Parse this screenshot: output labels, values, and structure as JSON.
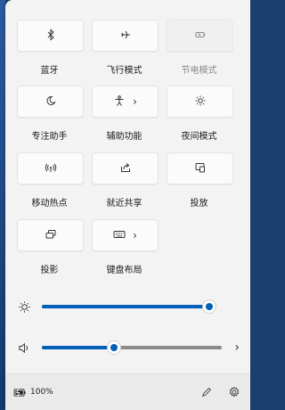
{
  "tiles": [
    {
      "label": "蓝牙",
      "icon": "bluetooth-icon",
      "chevron": false,
      "disabled": false
    },
    {
      "label": "飞行模式",
      "icon": "airplane-icon",
      "chevron": false,
      "disabled": false
    },
    {
      "label": "节电模式",
      "icon": "battery-saver-icon",
      "chevron": false,
      "disabled": true
    },
    {
      "label": "专注助手",
      "icon": "moon-icon",
      "chevron": false,
      "disabled": false
    },
    {
      "label": "辅助功能",
      "icon": "accessibility-icon",
      "chevron": true,
      "disabled": false
    },
    {
      "label": "夜间模式",
      "icon": "brightness-icon",
      "chevron": false,
      "disabled": false
    },
    {
      "label": "移动热点",
      "icon": "hotspot-icon",
      "chevron": false,
      "disabled": false
    },
    {
      "label": "就近共享",
      "icon": "share-icon",
      "chevron": false,
      "disabled": false
    },
    {
      "label": "投放",
      "icon": "cast-icon",
      "chevron": false,
      "disabled": false
    },
    {
      "label": "投影",
      "icon": "project-icon",
      "chevron": false,
      "disabled": false
    },
    {
      "label": "键盘布局",
      "icon": "keyboard-icon",
      "chevron": true,
      "disabled": false
    }
  ],
  "chevron_glyph": "›",
  "brightness": {
    "icon": "sun-icon",
    "value_percent": 96
  },
  "volume": {
    "icon": "speaker-icon",
    "value_percent": 40,
    "chevron_glyph": "›"
  },
  "footer": {
    "battery_icon": "battery-charging-icon",
    "battery_text": "100%",
    "edit_icon": "pencil-icon",
    "settings_icon": "gear-icon"
  },
  "accent_color": "#005fb8"
}
